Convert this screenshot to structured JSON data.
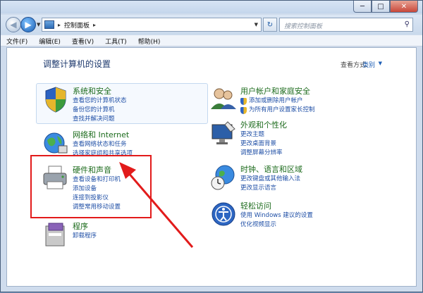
{
  "window": {
    "controls": {
      "min": "─",
      "max": "□",
      "close": "✕"
    }
  },
  "address": {
    "breadcrumb": "控制面板",
    "separator": "▸",
    "search_placeholder": "搜索控制面板"
  },
  "menu": [
    "文件(F)",
    "编辑(E)",
    "查看(V)",
    "工具(T)",
    "帮助(H)"
  ],
  "page": {
    "title": "调整计算机的设置",
    "view_label": "查看方式:",
    "view_value": "类别"
  },
  "categories": {
    "system": {
      "title": "系统和安全",
      "links": [
        "查看您的计算机状态",
        "备份您的计算机",
        "查找并解决问题"
      ]
    },
    "network": {
      "title": "网络和 Internet",
      "links": [
        "查看网络状态和任务",
        "选择家庭组和共享选项"
      ]
    },
    "hardware": {
      "title": "硬件和声音",
      "links": [
        "查看设备和打印机",
        "添加设备",
        "连接到投影仪",
        "调整常用移动设置"
      ]
    },
    "programs": {
      "title": "程序",
      "links": [
        "卸载程序"
      ]
    },
    "users": {
      "title": "用户帐户和家庭安全",
      "links": [
        "添加或删除用户帐户",
        "为所有用户设置家长控制"
      ]
    },
    "appearance": {
      "title": "外观和个性化",
      "links": [
        "更改主题",
        "更改桌面背景",
        "调整屏幕分辨率"
      ]
    },
    "clock": {
      "title": "时钟、语言和区域",
      "links": [
        "更改键盘或其他输入法",
        "更改显示语言"
      ]
    },
    "ease": {
      "title": "轻松访问",
      "links": [
        "使用 Windows 建议的设置",
        "优化视频显示"
      ]
    }
  },
  "colors": {
    "category_title": "#1c6b1c",
    "link": "#1f4fa6",
    "annotation": "#e21b1b"
  }
}
